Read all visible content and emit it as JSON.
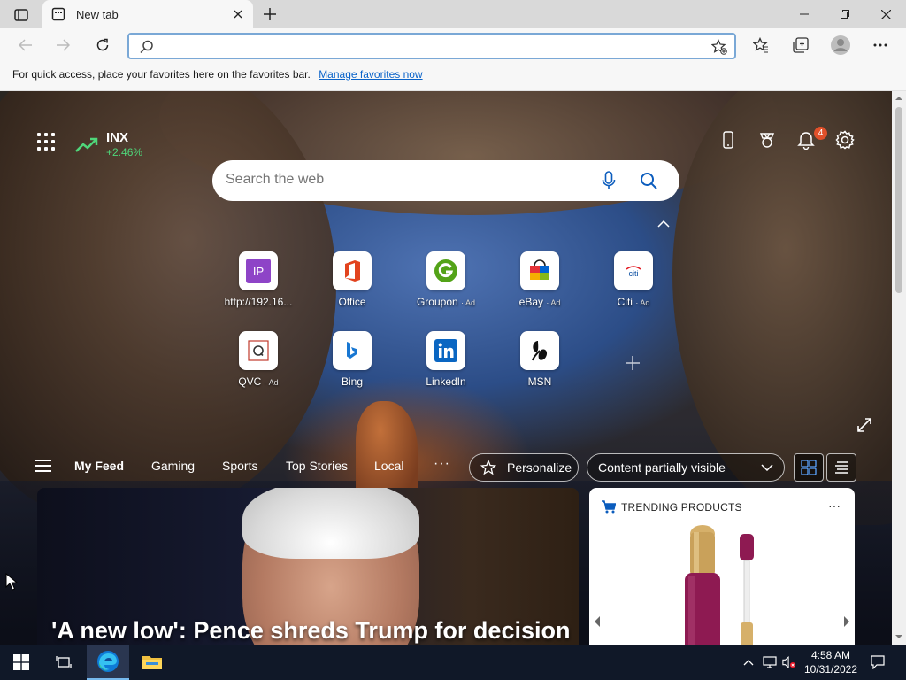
{
  "browser": {
    "tab_title": "New tab",
    "address_value": "",
    "favbar_text": "For quick access, place your favorites here on the favorites bar.",
    "favbar_link": "Manage favorites now"
  },
  "page": {
    "stock": {
      "name": "INX",
      "change": "+2.46%"
    },
    "notifications_count": "4",
    "search_placeholder": "Search the web",
    "quicklinks": [
      {
        "label": "http://192.16...",
        "ad": "",
        "icon": "ip-icon"
      },
      {
        "label": "Office",
        "ad": "",
        "icon": "office-icon"
      },
      {
        "label": "Groupon",
        "ad": "· Ad",
        "icon": "groupon-icon"
      },
      {
        "label": "eBay",
        "ad": "· Ad",
        "icon": "ebay-icon"
      },
      {
        "label": "Citi",
        "ad": "· Ad",
        "icon": "citi-icon"
      },
      {
        "label": "QVC",
        "ad": "· Ad",
        "icon": "qvc-icon"
      },
      {
        "label": "Bing",
        "ad": "",
        "icon": "bing-icon"
      },
      {
        "label": "LinkedIn",
        "ad": "",
        "icon": "linkedin-icon"
      },
      {
        "label": "MSN",
        "ad": "",
        "icon": "msn-icon"
      }
    ],
    "feed_tabs": [
      "My Feed",
      "Gaming",
      "Sports",
      "Top Stories",
      "Local"
    ],
    "feed_more": "···",
    "personalize_label": "Personalize",
    "content_visibility": "Content partially visible",
    "hero_headline": "'A new low': Pence shreds Trump for decision",
    "trending_title": "TRENDING PRODUCTS",
    "trending_more": "···"
  },
  "taskbar": {
    "time": "4:58 AM",
    "date": "10/31/2022"
  },
  "colors": {
    "stock_up": "#4fd67a",
    "badge": "#e0502a",
    "address_focus": "#7aa8d6",
    "link": "#0a63c9"
  }
}
